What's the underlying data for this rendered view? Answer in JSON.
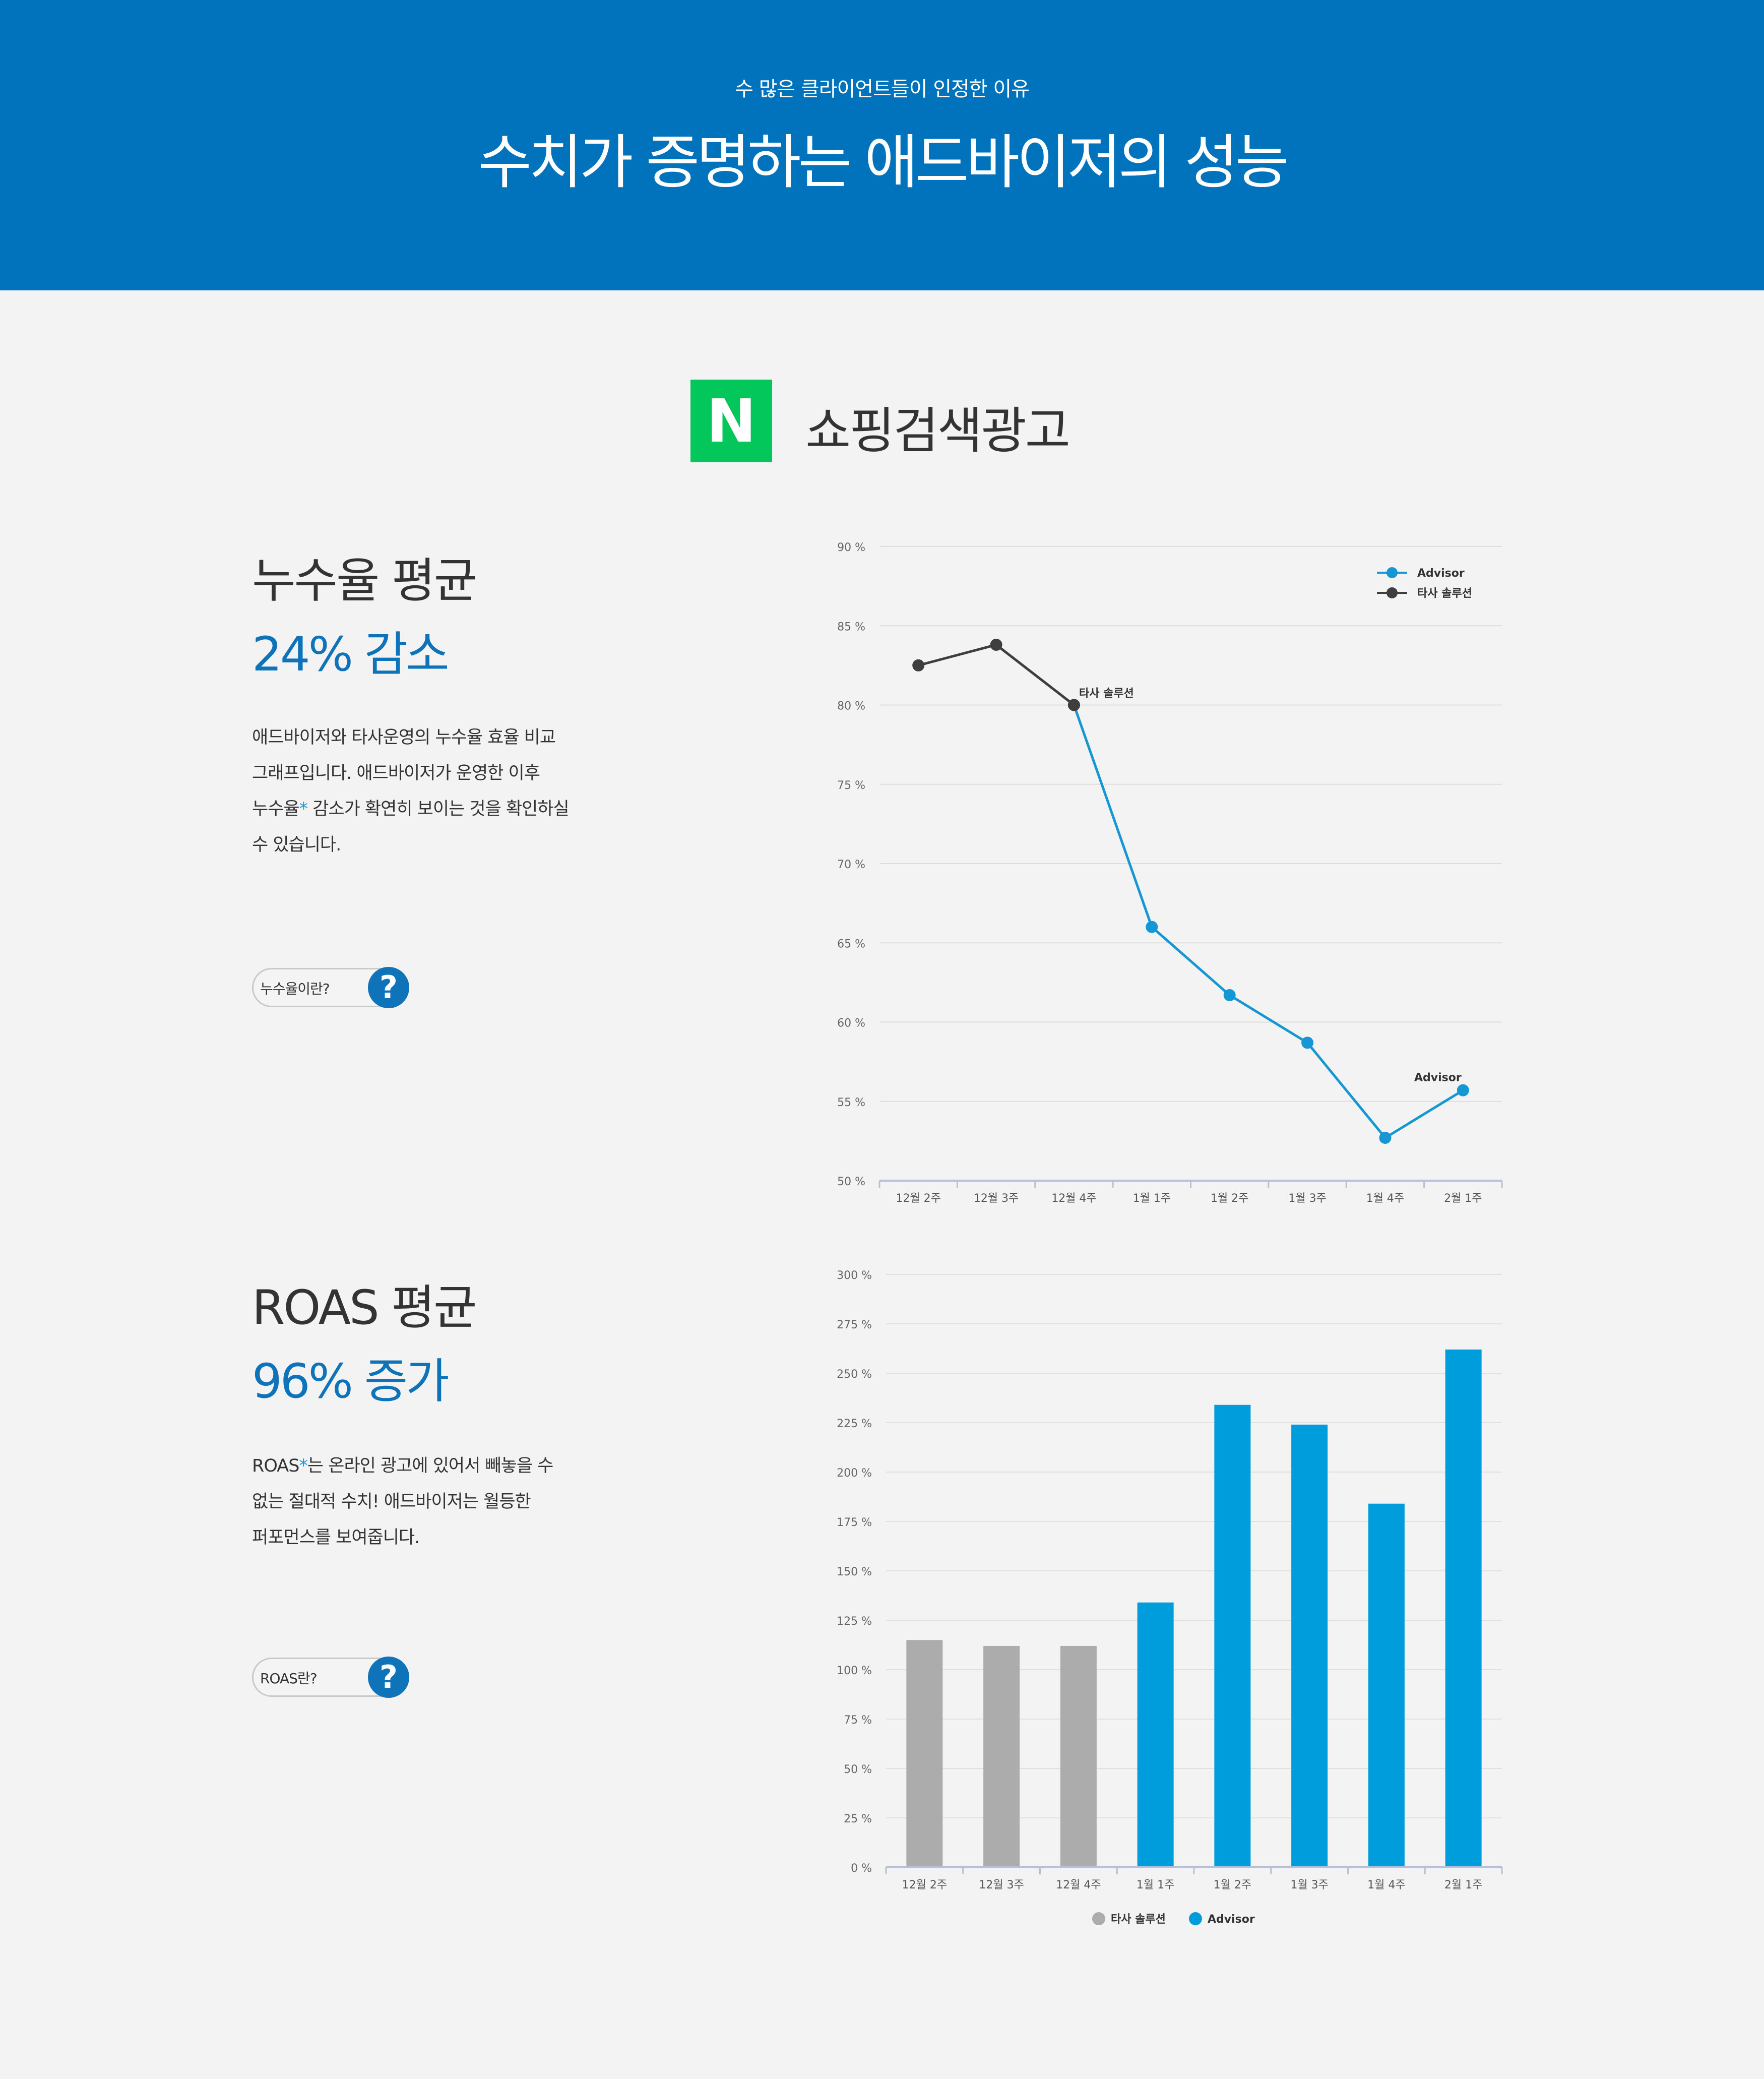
{
  "header": {
    "subtitle": "수 많은 클라이언트들이 인정한 이유",
    "title": "수치가 증명하는 애드바이저의 성능"
  },
  "brand": {
    "logo_letter": "N",
    "title": "쇼핑검색광고",
    "logo_color": "#03c75a"
  },
  "metric1": {
    "title": "누수율 평균",
    "value": "24% 감소",
    "desc_line1": "애드바이저와 타사운영의 누수율 효율 비교",
    "desc_line2": "그래프입니다. 애드바이저가 운영한 이후",
    "desc_line3_a": "누수율",
    "desc_star": "*",
    "desc_line3_b": " 감소가 확연히 보이는 것을 확인하실",
    "desc_line4": "수 있습니다.",
    "help_label": "누수율이란?",
    "help_icon": "?"
  },
  "metric2": {
    "title": "ROAS 평균",
    "value": "96% 증가",
    "desc_line1_a": "ROAS",
    "desc_star": "*",
    "desc_line1_b": "는 온라인 광고에 있어서 빼놓을 수",
    "desc_line2": "없는 절대적 수치! 애드바이저는 월등한",
    "desc_line3": "퍼포먼스를 보여줍니다.",
    "help_label": "ROAS란?",
    "help_icon": "?"
  },
  "colors": {
    "header_bg": "#0073bc",
    "accent_blue": "#0e73b8",
    "advisor_blue": "#1597d3",
    "bar_blue": "#009ddc",
    "competitor_dark": "#3e3e3e",
    "competitor_gray": "#acacac"
  },
  "chart_data": [
    {
      "type": "line",
      "categories": [
        "12월 2주",
        "12월 3주",
        "12월 4주",
        "1월 1주",
        "1월 2주",
        "1월 3주",
        "1월 4주",
        "2월 1주"
      ],
      "ylim": [
        50,
        90
      ],
      "yticks": [
        90,
        85,
        80,
        75,
        70,
        65,
        60,
        55,
        50
      ],
      "ytick_labels": [
        "90 %",
        "85 %",
        "80 %",
        "75 %",
        "70 %",
        "65 %",
        "60 %",
        "55 %",
        "50 %"
      ],
      "grid": true,
      "legend_position": "top-right",
      "series": [
        {
          "name": "Advisor",
          "values": [
            null,
            null,
            80,
            66,
            61.7,
            58.7,
            52.7,
            55.7
          ]
        },
        {
          "name": "타사 솔루션",
          "values": [
            82.5,
            83.8,
            80,
            null,
            null,
            null,
            null,
            null
          ]
        }
      ],
      "annotations": [
        {
          "text": "타사 솔루션",
          "category": "12월 4주",
          "value": 80
        },
        {
          "text": "Advisor",
          "category": "2월 1주",
          "value": 55.7
        }
      ]
    },
    {
      "type": "bar",
      "categories": [
        "12월 2주",
        "12월 3주",
        "12월 4주",
        "1월 1주",
        "1월 2주",
        "1월 3주",
        "1월 4주",
        "2월 1주"
      ],
      "ylim": [
        0,
        300
      ],
      "yticks": [
        300,
        275,
        250,
        225,
        200,
        175,
        150,
        125,
        100,
        75,
        50,
        25,
        0
      ],
      "ytick_labels": [
        "300 %",
        "275 %",
        "250 %",
        "225 %",
        "200 %",
        "175 %",
        "150 %",
        "125 %",
        "100 %",
        "75 %",
        "50 %",
        "25 %",
        "0 %"
      ],
      "grid": true,
      "legend_position": "bottom",
      "series": [
        {
          "name": "타사 솔루션",
          "values": [
            115,
            112,
            112,
            null,
            null,
            null,
            null,
            null
          ]
        },
        {
          "name": "Advisor",
          "values": [
            null,
            null,
            null,
            134,
            234,
            224,
            184,
            262
          ]
        }
      ]
    }
  ]
}
